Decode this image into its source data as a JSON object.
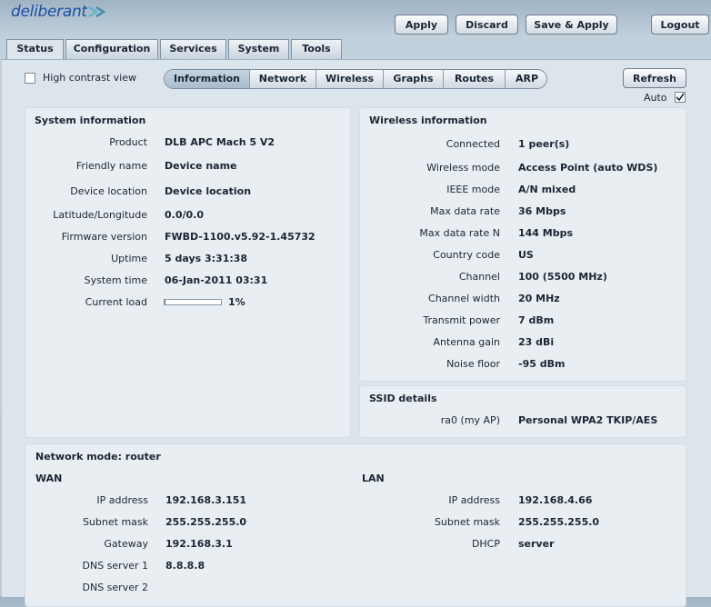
{
  "brand": {
    "logo_text": "deliberant"
  },
  "header_buttons": {
    "apply": "Apply",
    "discard": "Discard",
    "save_apply": "Save & Apply",
    "logout": "Logout"
  },
  "tabs": [
    "Status",
    "Configuration",
    "Services",
    "System",
    "Tools"
  ],
  "toolbar": {
    "high_contrast_label": "High contrast view",
    "refresh": "Refresh",
    "auto_label": "Auto",
    "auto_checked": true
  },
  "subnav": [
    "Information",
    "Network",
    "Wireless",
    "Graphs",
    "Routes",
    "ARP"
  ],
  "system_info": {
    "title": "System information",
    "rows": [
      {
        "label": "Product",
        "value": "DLB APC Mach 5 V2"
      },
      {
        "label": "Friendly name",
        "value": "Device name"
      },
      {
        "label": "Device location",
        "value": "Device location"
      },
      {
        "label": "Latitude/Longitude",
        "value": "0.0/0.0"
      },
      {
        "label": "Firmware version",
        "value": "FWBD-1100.v5.92-1.45732"
      },
      {
        "label": "Uptime",
        "value": "5 days 3:31:38"
      },
      {
        "label": "System time",
        "value": "06-Jan-2011 03:31"
      },
      {
        "label": "Current load",
        "value": "1%",
        "load_fraction": 0.01
      }
    ]
  },
  "wireless_info": {
    "title": "Wireless information",
    "rows": [
      {
        "label": "Connected",
        "value": "1 peer(s)"
      },
      {
        "label": "Wireless mode",
        "value": "Access Point (auto WDS)"
      },
      {
        "label": "IEEE mode",
        "value": "A/N mixed"
      },
      {
        "label": "Max data rate",
        "value": "36 Mbps"
      },
      {
        "label": "Max data rate N",
        "value": "144 Mbps"
      },
      {
        "label": "Country code",
        "value": "US"
      },
      {
        "label": "Channel",
        "value": "100 (5500 MHz)"
      },
      {
        "label": "Channel width",
        "value": "20 MHz"
      },
      {
        "label": "Transmit power",
        "value": "7 dBm"
      },
      {
        "label": "Antenna gain",
        "value": "23 dBi"
      },
      {
        "label": "Noise floor",
        "value": "-95 dBm"
      }
    ]
  },
  "ssid": {
    "title": "SSID details",
    "label": "ra0 (my AP)",
    "value": "Personal WPA2 TKIP/AES"
  },
  "network": {
    "title": "Network mode: router",
    "wan": {
      "title": "WAN",
      "rows": [
        {
          "label": "IP address",
          "value": "192.168.3.151"
        },
        {
          "label": "Subnet mask",
          "value": "255.255.255.0"
        },
        {
          "label": "Gateway",
          "value": "192.168.3.1"
        },
        {
          "label": "DNS server 1",
          "value": "8.8.8.8"
        },
        {
          "label": "DNS server 2",
          "value": ""
        }
      ]
    },
    "lan": {
      "title": "LAN",
      "rows": [
        {
          "label": "IP address",
          "value": "192.168.4.66"
        },
        {
          "label": "Subnet mask",
          "value": "255.255.255.0"
        },
        {
          "label": "DHCP",
          "value": "server"
        }
      ]
    }
  },
  "colors": {
    "brand": "#1c4fa3",
    "accent": "#5fb8c8",
    "background": "#bccbd8",
    "panel": "#dde5ec"
  }
}
